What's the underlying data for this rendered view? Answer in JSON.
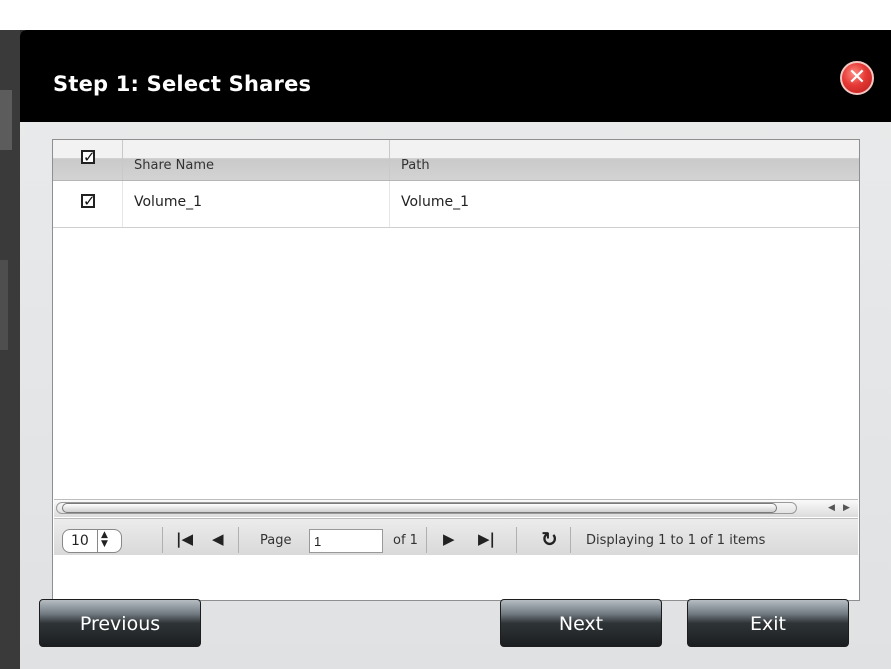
{
  "dialog": {
    "title": "Step 1: Select Shares",
    "close_icon": "x-icon"
  },
  "table": {
    "columns": [
      "Share Name",
      "Path"
    ],
    "header_checked": true,
    "rows": [
      {
        "checked": true,
        "share_name": "Volume_1",
        "path": "Volume_1"
      }
    ]
  },
  "pager": {
    "rows_per_page": "10",
    "page_label": "Page",
    "page_value": "1",
    "of_label": "of 1",
    "status": "Displaying 1 to 1 of 1 items"
  },
  "buttons": {
    "previous": "Previous",
    "next": "Next",
    "exit": "Exit"
  },
  "colors": {
    "titlebar": "#000000",
    "close": "#e53935"
  }
}
